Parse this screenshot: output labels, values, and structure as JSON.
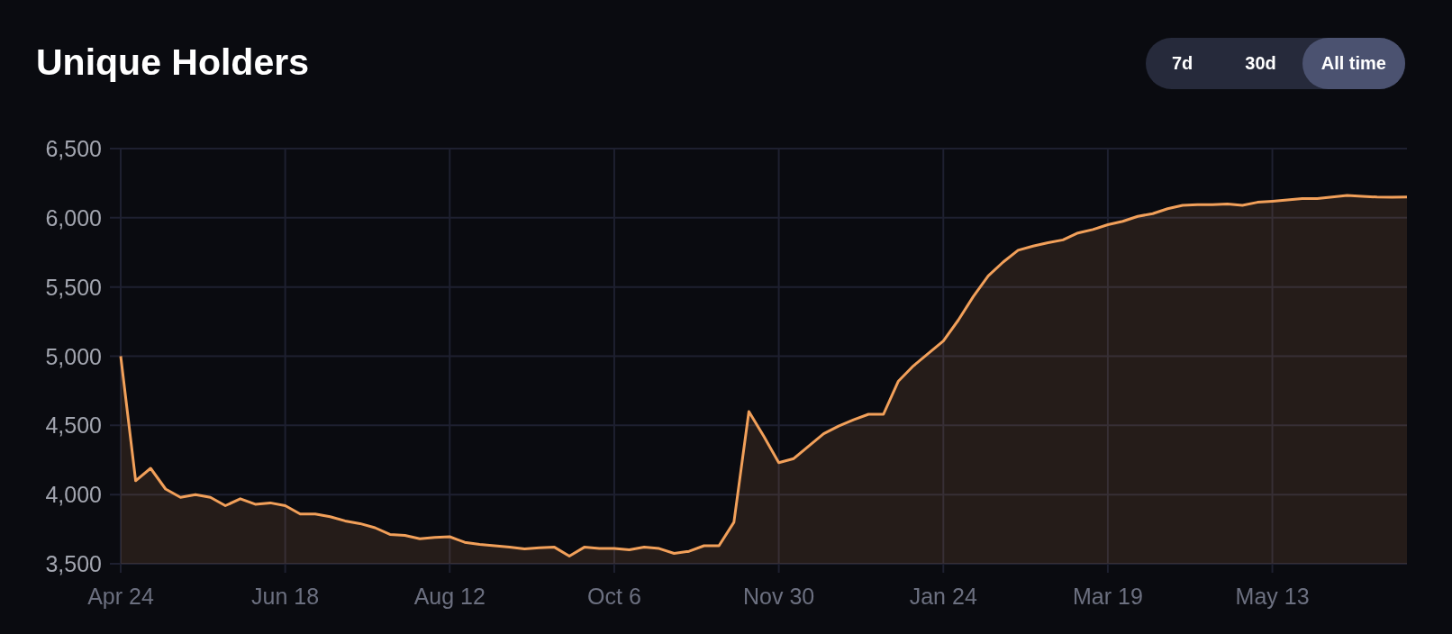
{
  "range_tabs": [
    {
      "label": "7d",
      "selected": false
    },
    {
      "label": "30d",
      "selected": false
    },
    {
      "label": "All time",
      "selected": true
    }
  ],
  "chart_data": {
    "type": "area",
    "title": "Unique Holders",
    "categories": [
      "Apr 24",
      null,
      null,
      null,
      null,
      null,
      null,
      null,
      null,
      null,
      null,
      "Jun 18",
      null,
      null,
      null,
      null,
      null,
      null,
      null,
      null,
      null,
      null,
      "Aug 12",
      null,
      null,
      null,
      null,
      null,
      null,
      null,
      null,
      null,
      null,
      "Oct 6",
      null,
      null,
      null,
      null,
      null,
      null,
      null,
      null,
      null,
      null,
      "Nov 30",
      null,
      null,
      null,
      null,
      null,
      null,
      null,
      null,
      null,
      null,
      "Jan 24",
      null,
      null,
      null,
      null,
      null,
      null,
      null,
      null,
      null,
      null,
      "Mar 19",
      null,
      null,
      null,
      null,
      null,
      null,
      null,
      null,
      null,
      null,
      "May 13",
      null,
      null,
      null,
      null,
      null,
      null,
      null,
      null,
      null
    ],
    "series": [
      {
        "color": "#f2a05a",
        "values": [
          5000,
          4100,
          4190,
          4040,
          3980,
          4000,
          3980,
          3920,
          3970,
          3930,
          3940,
          3920,
          3860,
          3860,
          3840,
          3810,
          3790,
          3760,
          3712,
          3705,
          3680,
          3690,
          3695,
          3655,
          3640,
          3630,
          3620,
          3608,
          3615,
          3620,
          3555,
          3620,
          3610,
          3610,
          3600,
          3620,
          3610,
          3575,
          3590,
          3630,
          3630,
          3800,
          4600,
          4420,
          4230,
          4260,
          4350,
          4440,
          4495,
          4540,
          4580,
          4580,
          4820,
          4930,
          5020,
          5110,
          5260,
          5430,
          5580,
          5680,
          5765,
          5795,
          5820,
          5840,
          5890,
          5915,
          5950,
          5975,
          6010,
          6030,
          6065,
          6090,
          6095,
          6095,
          6100,
          6090,
          6112,
          6120,
          6130,
          6138,
          6138,
          6150,
          6162,
          6155,
          6150,
          6148,
          6150
        ]
      }
    ],
    "grid": true,
    "ylim": [
      3500,
      6500
    ],
    "yticks": [
      {
        "value": 3500,
        "label": "3,500"
      },
      {
        "value": 4000,
        "label": "4,000"
      },
      {
        "value": 4500,
        "label": "4,500"
      },
      {
        "value": 5000,
        "label": "5,000"
      },
      {
        "value": 5500,
        "label": "5,500"
      },
      {
        "value": 6000,
        "label": "6,000"
      },
      {
        "value": 6500,
        "label": "6,500"
      }
    ]
  }
}
